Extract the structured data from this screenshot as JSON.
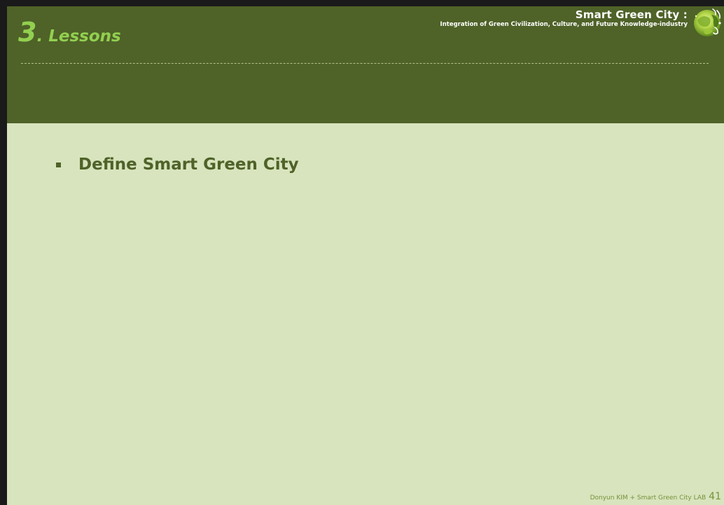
{
  "header": {
    "section_number": "3",
    "section_title": ". Lessons",
    "brand_title": "Smart Green City :",
    "brand_subtitle": "Integration  of Green  Civilization,  Culture, and  Future Knowledge-industry",
    "logo_icon": "green-globe-logo-icon"
  },
  "content": {
    "bullets": [
      {
        "text": "Define Smart Green City"
      }
    ]
  },
  "footer": {
    "credit": "Donyun KIM + Smart Green City LAB",
    "page_number": "41"
  },
  "colors": {
    "header_background": "#4f6228",
    "slide_background": "#d8e4bd",
    "title_accent": "#92d050",
    "bullet_text": "#4f6228",
    "footer_text": "#76923c"
  }
}
